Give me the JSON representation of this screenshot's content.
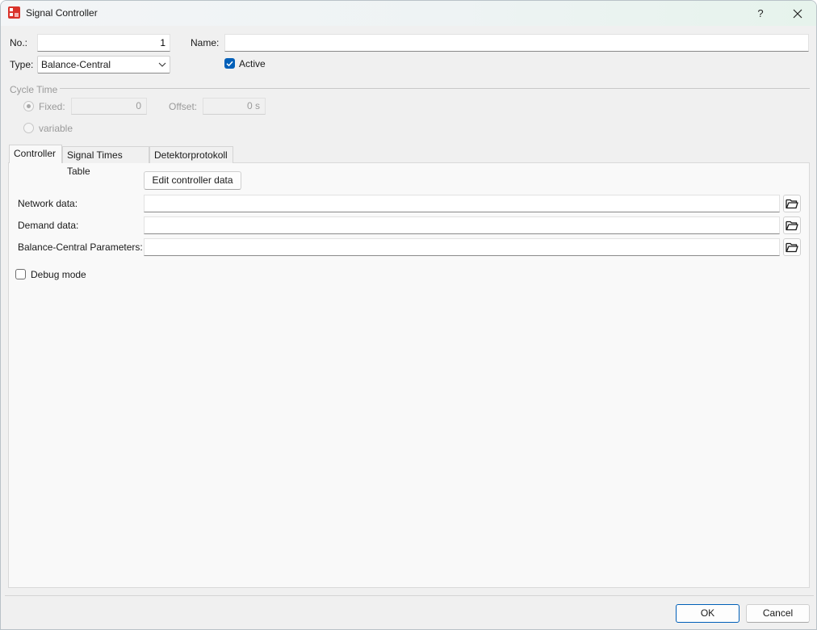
{
  "window": {
    "title": "Signal Controller",
    "help_label": "?",
    "close_label": "✕"
  },
  "general": {
    "no_label": "No.:",
    "no_value": "1",
    "name_label": "Name:",
    "name_value": "",
    "type_label": "Type:",
    "type_value": "Balance-Central",
    "active_label": "Active",
    "active_checked": true
  },
  "cycle_time": {
    "title": "Cycle Time",
    "fixed_label": "Fixed:",
    "fixed_value": "0",
    "offset_label": "Offset:",
    "offset_value": "0 s",
    "variable_label": "variable",
    "selected": "fixed"
  },
  "tabs": [
    {
      "label": "Controller",
      "active": true
    },
    {
      "label": "Signal Times Table",
      "active": false
    },
    {
      "label": "Detektorprotokoll",
      "active": false
    }
  ],
  "controller_tab": {
    "edit_button_label": "Edit controller data",
    "network_label": "Network data:",
    "network_value": "",
    "demand_label": "Demand data:",
    "demand_value": "",
    "params_label": "Balance-Central Parameters:",
    "params_value": "",
    "debug_label": "Debug mode",
    "debug_checked": false
  },
  "footer": {
    "ok_label": "OK",
    "cancel_label": "Cancel"
  },
  "colors": {
    "accent": "#005fb8",
    "app_icon": "#d9342b"
  }
}
